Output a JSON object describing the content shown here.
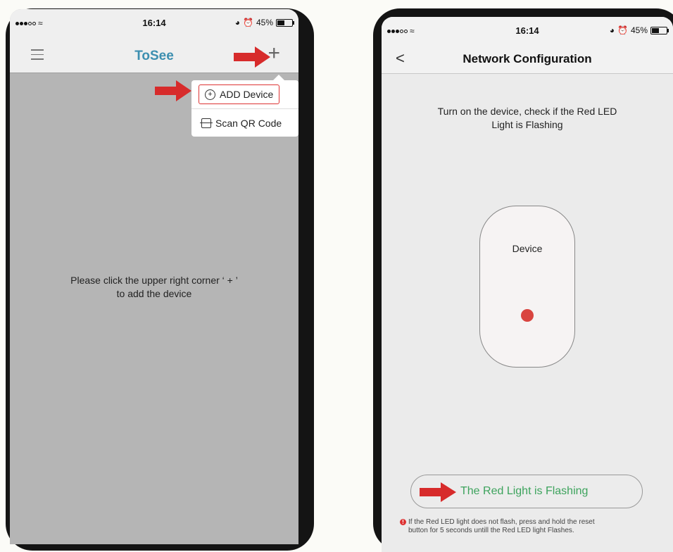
{
  "left_screen": {
    "status": {
      "time": "16:14",
      "battery": "45%"
    },
    "app_title": "ToSee",
    "plus_label": "+",
    "menu": {
      "add_device": "ADD Device",
      "scan_qr": "Scan QR Code"
    },
    "hint_line1": "Please click the upper right corner ‘ + ’",
    "hint_line2": "to add the device"
  },
  "right_screen": {
    "status": {
      "time": "16:14",
      "battery": "45%"
    },
    "back_label": "<",
    "title": "Network Configuration",
    "instruction_line1": "Turn on the device, check if the Red LED",
    "instruction_line2": "Light is Flashing",
    "device_label": "Device",
    "flash_button": "The Red Light is Flashing",
    "note_line1": "If the Red LED light does not flash, press and hold the reset",
    "note_line2": "button for 5 seconds untill the Red LED light Flashes."
  },
  "colors": {
    "brand": "#3d8fb0",
    "arrow": "#d72b2b",
    "led": "#d9443f",
    "confirm_text": "#3da35d"
  },
  "icons": [
    "menu-icon",
    "plus-icon",
    "circle-plus-icon",
    "scan-icon",
    "back-chevron-icon",
    "alarm-icon",
    "warning-icon"
  ]
}
